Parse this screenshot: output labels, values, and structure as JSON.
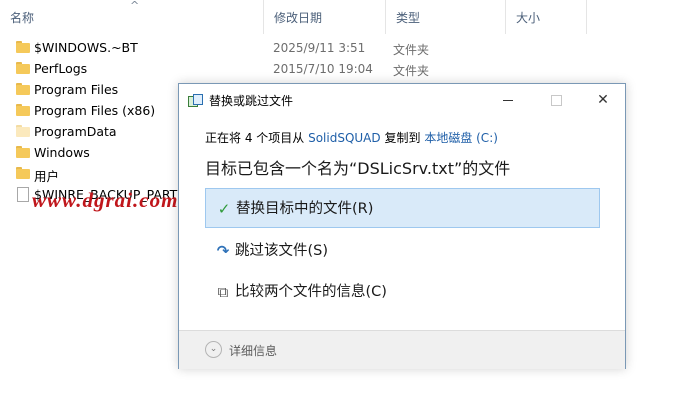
{
  "columns": {
    "name": "名称",
    "date": "修改日期",
    "type": "类型",
    "size": "大小"
  },
  "files": [
    {
      "name": "$WINDOWS.~BT",
      "date": "2025/9/11 3:51",
      "type": "文件夹",
      "icon": "folder-icon"
    },
    {
      "name": "PerfLogs",
      "date": "2015/7/10 19:04",
      "type": "文件夹",
      "icon": "folder-icon"
    },
    {
      "name": "Program Files",
      "icon": "folder-icon"
    },
    {
      "name": "Program Files (x86)",
      "icon": "folder-icon"
    },
    {
      "name": "ProgramData",
      "icon": "folder-icon"
    },
    {
      "name": "Windows",
      "icon": "folder-icon"
    },
    {
      "name": "用户",
      "icon": "folder-icon"
    },
    {
      "name": "$WINRE_BACKUP_PARTIT",
      "icon": "file-icon"
    }
  ],
  "watermark": "www.dgrai.com",
  "dialog": {
    "title": "替换或跳过文件",
    "progress_prefix": "正在将 4 个项目从",
    "source": "SolidSQUAD",
    "progress_mid": "复制到",
    "destination": "本地磁盘 (C:)",
    "headline": "目标已包含一个名为“DSLicSrv.txt”的文件",
    "options": {
      "replace": "替换目标中的文件(R)",
      "skip": "跳过该文件(S)",
      "compare": "比较两个文件的信息(C)"
    },
    "more_details": "详细信息"
  },
  "colors": {
    "link": "#1f5fa8",
    "selected_option_bg": "#d9eaf9",
    "watermark": "#c0161b",
    "check": "#2f9a3a"
  }
}
